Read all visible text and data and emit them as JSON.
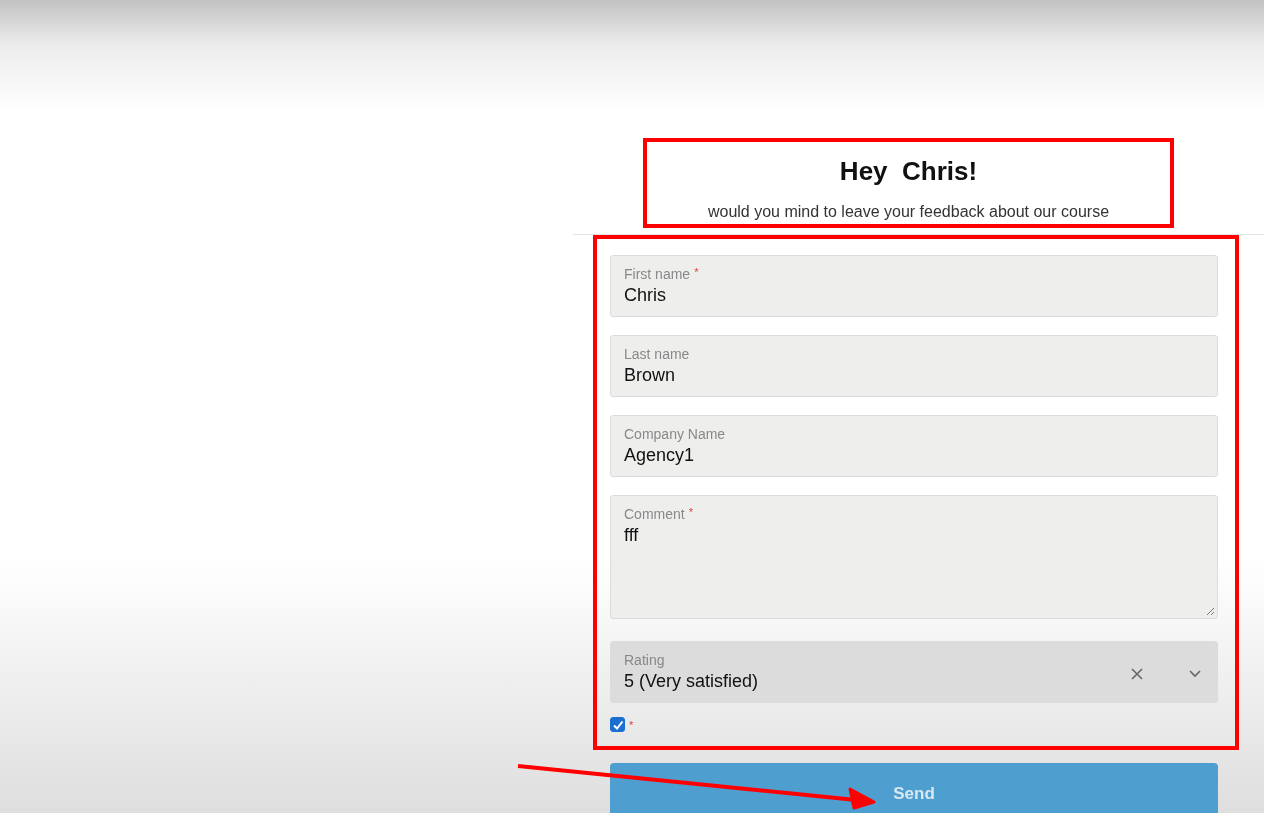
{
  "header": {
    "title": "Hey  Chris!",
    "subtitle": "would you mind to leave your feedback about our course"
  },
  "fields": [
    {
      "kind": "text",
      "label": "First name",
      "required_mark": "*",
      "value": "Chris"
    },
    {
      "kind": "text",
      "label": "Last name",
      "value": "Brown"
    },
    {
      "kind": "text",
      "label": "Company Name",
      "value": "Agency1"
    },
    {
      "kind": "textarea",
      "label": "Comment",
      "required_mark": "*",
      "value": "fff"
    },
    {
      "kind": "select",
      "label": "Rating",
      "value": "5 (Very satisfied)"
    }
  ],
  "consent": {
    "checked": true,
    "required_mark": "*"
  },
  "submit": {
    "label": "Send"
  }
}
